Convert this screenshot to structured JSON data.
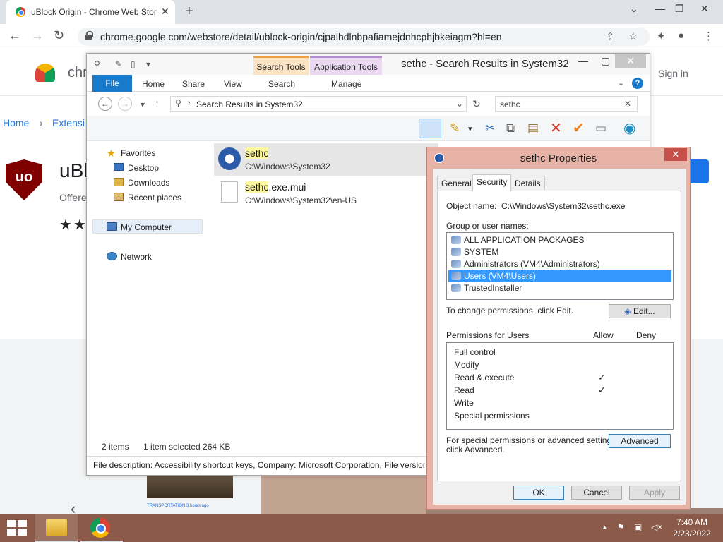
{
  "chrome": {
    "tab_title": "uBlock Origin - Chrome Web Store",
    "url": "chrome.google.com/webstore/detail/ublock-origin/cjpalhdlnbpafiamejdnhcphjbkeiagm?hl=en",
    "close_glyph": "✕",
    "newtab_glyph": "+"
  },
  "webstore": {
    "logo_text": "chr",
    "signin": "Sign in",
    "crumb_home": "Home",
    "crumb_sep": "›",
    "crumb_ext": "Extensi",
    "ext_title": "uBl",
    "offered": "Offere",
    "stars": "★★",
    "shield_text": "uo",
    "card_caption": "TRANSPORTATION  3 hours ago"
  },
  "explorer": {
    "window_title": "sethc - Search Results in System32",
    "context_search": "Search Tools",
    "context_app": "Application Tools",
    "tabs": [
      "File",
      "Home",
      "Share",
      "View",
      "Search",
      "Manage"
    ],
    "address": "Search Results in System32",
    "search_value": "sethc",
    "nav": {
      "favorites": "Favorites",
      "desktop": "Desktop",
      "downloads": "Downloads",
      "recent": "Recent places",
      "computer": "My Computer",
      "network": "Network"
    },
    "results": [
      {
        "hl": "sethc",
        "rest": "",
        "path": "C:\\Windows\\System32"
      },
      {
        "hl": "sethc",
        "rest": ".exe.mui",
        "path": "C:\\Windows\\System32\\en-US"
      }
    ],
    "status_items": "2 items",
    "status_selected": "1 item selected  264 KB",
    "details": "File description: Accessibility shortcut keys, Company: Microsoft Corporation, File version"
  },
  "props": {
    "title": "sethc Properties",
    "tabs": [
      "General",
      "Security",
      "Details"
    ],
    "object_label": "Object name:",
    "object_value": "C:\\Windows\\System32\\sethc.exe",
    "group_label": "Group or user names:",
    "groups": [
      "ALL APPLICATION PACKAGES",
      "SYSTEM",
      "Administrators (VM4\\Administrators)",
      "Users (VM4\\Users)",
      "TrustedInstaller"
    ],
    "change_text": "To change permissions, click Edit.",
    "edit_btn": "Edit...",
    "perm_label": "Permissions for Users",
    "allow": "Allow",
    "deny": "Deny",
    "permissions": [
      {
        "name": "Full control",
        "allow": ""
      },
      {
        "name": "Modify",
        "allow": ""
      },
      {
        "name": "Read & execute",
        "allow": "✓"
      },
      {
        "name": "Read",
        "allow": "✓"
      },
      {
        "name": "Write",
        "allow": ""
      },
      {
        "name": "Special permissions",
        "allow": ""
      }
    ],
    "special_text_1": "For special permissions or advanced settings,",
    "special_text_2": "click Advanced.",
    "advanced_btn": "Advanced",
    "ok": "OK",
    "cancel": "Cancel",
    "apply": "Apply"
  },
  "taskbar": {
    "time": "7:40 AM",
    "date": "2/23/2022"
  },
  "colors": {
    "accent": "#1979ca",
    "selection": "#3399ff",
    "dialog_frame": "#e7b3a6",
    "taskbar": "#8b5a48"
  }
}
